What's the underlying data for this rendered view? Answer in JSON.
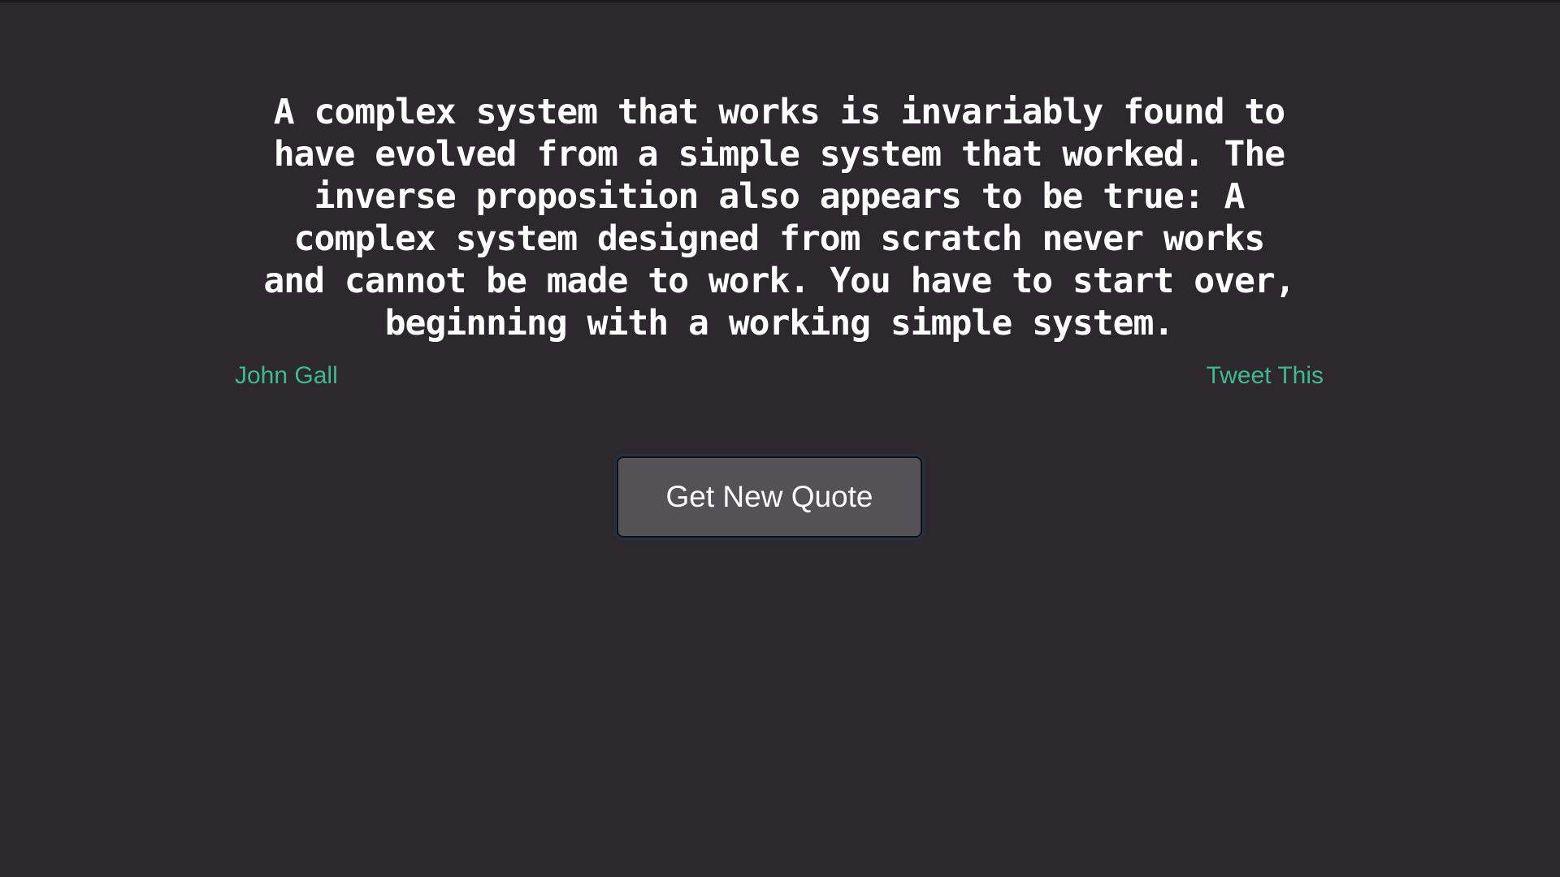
{
  "quote": {
    "text": "A complex system that works is invariably found to have evolved from a simple system that worked. The inverse proposition also appears to be true: A complex system designed from scratch never works and cannot be made to work. You have to start over, beginning with a working simple system.",
    "author": "John Gall"
  },
  "actions": {
    "tweet_label": "Tweet This",
    "new_quote_label": "Get New Quote"
  },
  "colors": {
    "background": "#2c282e",
    "accent": "#3dba8f",
    "button": "#545157"
  }
}
